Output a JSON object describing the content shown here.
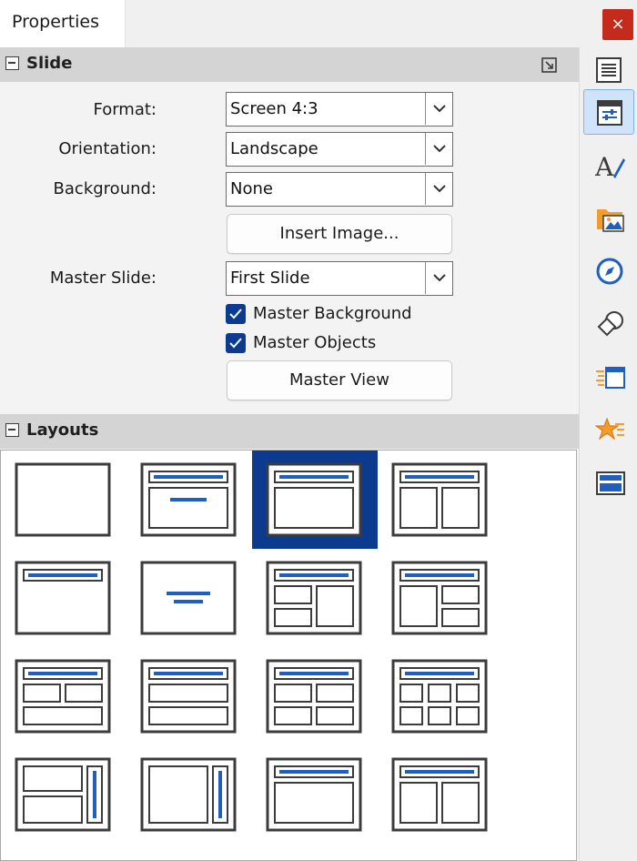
{
  "window": {
    "title": "Properties",
    "close_symbol": "×"
  },
  "slide_section": {
    "title": "Slide",
    "format": {
      "label": "Format:",
      "value": "Screen 4:3"
    },
    "orientation": {
      "label": "Orientation:",
      "value": "Landscape"
    },
    "background": {
      "label": "Background:",
      "value": "None"
    },
    "insert_image_label": "Insert Image...",
    "master_slide": {
      "label": "Master Slide:",
      "value": "First Slide"
    },
    "master_background": {
      "label": "Master Background",
      "checked": true
    },
    "master_objects": {
      "label": "Master Objects",
      "checked": true
    },
    "master_view_label": "Master View"
  },
  "layouts_section": {
    "title": "Layouts",
    "selected_index": 2,
    "items": [
      "blank-slide",
      "title-content",
      "title-and-content",
      "title-2-content",
      "title-only",
      "centered-text",
      "title-2-content-and-content",
      "title-content-and-2-content",
      "title-2-content-over-content",
      "title-content-over-content",
      "title-4-content",
      "title-6-content",
      "vertical-title-2-content",
      "vertical-title-content",
      "title-vertical-content",
      "title-2-vertical-content"
    ]
  },
  "sidebar_tabs": [
    {
      "name": "tab-menu",
      "icon": "hamburger-menu-icon",
      "active": false
    },
    {
      "name": "tab-properties",
      "icon": "properties-icon",
      "active": true
    },
    {
      "name": "tab-styles",
      "icon": "styles-icon",
      "active": false
    },
    {
      "name": "tab-gallery",
      "icon": "gallery-icon",
      "active": false
    },
    {
      "name": "tab-navigator",
      "icon": "navigator-icon",
      "active": false
    },
    {
      "name": "tab-shapes",
      "icon": "shapes-icon",
      "active": false
    },
    {
      "name": "tab-slide-transition",
      "icon": "slide-transition-icon",
      "active": false
    },
    {
      "name": "tab-animation",
      "icon": "animation-icon",
      "active": false
    },
    {
      "name": "tab-master-slides",
      "icon": "master-slides-icon",
      "active": false
    }
  ],
  "colors": {
    "accent": "#0b3a8f",
    "close_button": "#c42b1c",
    "layout_title_bar": "#1f5fbf",
    "layout_stroke": "#3c3c3c"
  }
}
